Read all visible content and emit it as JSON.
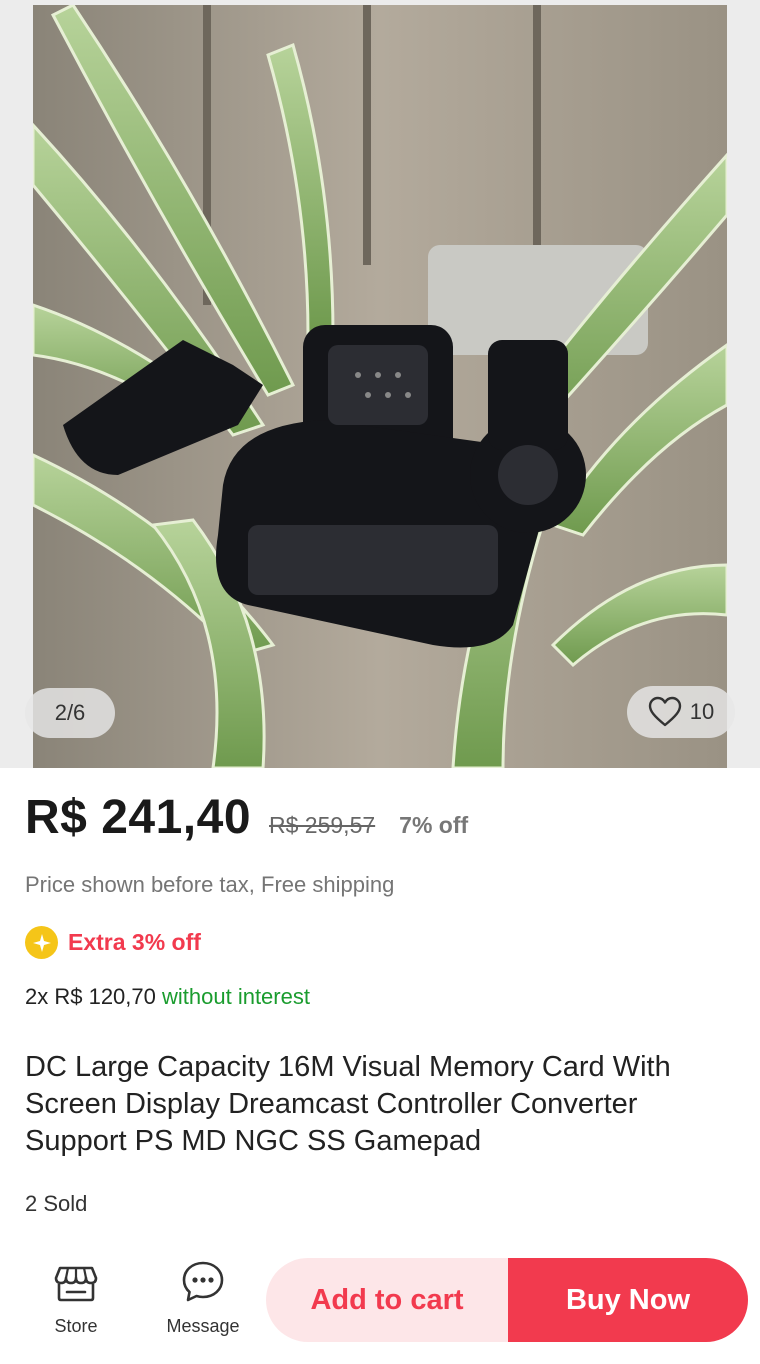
{
  "gallery": {
    "pager": "2/6",
    "wishlist_count": "10"
  },
  "price": {
    "current": "R$ 241,40",
    "original": "R$ 259,57",
    "discount": "7% off"
  },
  "tax_note": "Price shown before tax, Free shipping",
  "extra_offer": "Extra 3% off",
  "installment": {
    "plan": "2x R$ 120,70",
    "interest": "without interest"
  },
  "product_title": "DC Large Capacity 16M Visual Memory Card With Screen Display Dreamcast Controller Converter Support PS MD NGC SS Gamepad",
  "sold": "2 Sold",
  "bottom_bar": {
    "store_label": "Store",
    "message_label": "Message",
    "add_to_cart": "Add to cart",
    "buy_now": "Buy Now"
  },
  "colors": {
    "accent_red": "#f23a4e",
    "cart_bg": "#fde6e8",
    "interest_green": "#1a9c2e",
    "badge_yellow": "#f5c518"
  },
  "icons": [
    "heart-icon",
    "star-badge-icon",
    "store-icon",
    "message-icon"
  ]
}
